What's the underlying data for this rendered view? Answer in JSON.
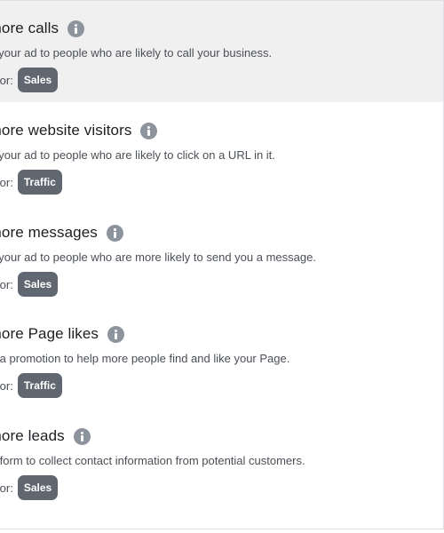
{
  "good_for_label": "od for:",
  "options": [
    {
      "title": "t more calls",
      "description": "ow your ad to people who are likely to call your business.",
      "badge": "Sales",
      "selected": true
    },
    {
      "title": "t more website visitors",
      "description": "ow your ad to people who are likely to click on a URL in it.",
      "badge": "Traffic",
      "selected": false
    },
    {
      "title": "t more messages",
      "description": "ow your ad to people who are more likely to send you a message.",
      "badge": "Sales",
      "selected": false
    },
    {
      "title": "t more Page likes",
      "description": "ate a promotion to help more people find and like your Page.",
      "badge": "Traffic",
      "selected": false
    },
    {
      "title": "t more leads",
      "description": "e a form to collect contact information from potential customers.",
      "badge": "Sales",
      "selected": false
    }
  ],
  "icons": {
    "info": "info-icon"
  }
}
